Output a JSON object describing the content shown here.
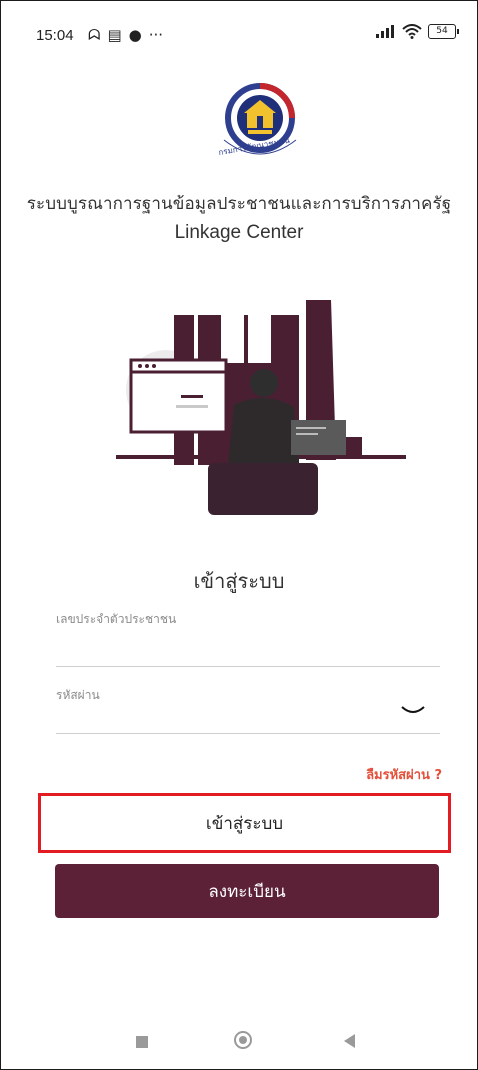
{
  "status_bar": {
    "time": "15:04",
    "battery": "54",
    "left_icons": [
      "notification-icon",
      "messages-icon",
      "chat-icon",
      "more-icon"
    ],
    "right_icons": [
      "signal-icon",
      "wifi-icon",
      "battery-icon"
    ]
  },
  "header": {
    "logo_text": "กรมการพัฒนาชุมชน",
    "title": "ระบบบูรณาการฐานข้อมูลประชาชนและการบริการภาครัฐ",
    "subtitle": "Linkage Center"
  },
  "login": {
    "title": "เข้าสู่ระบบ",
    "id_label": "เลขประจำตัวประชาชน",
    "id_value": "",
    "password_label": "รหัสผ่าน",
    "password_value": "",
    "forgot_label": "ลืมรหัสผ่าน ?",
    "login_button": "เข้าสู่ระบบ",
    "register_button": "ลงทะเบียน"
  },
  "colors": {
    "brand": "#5c2136",
    "forgot": "#e4513b",
    "highlight": "#e31b23"
  }
}
